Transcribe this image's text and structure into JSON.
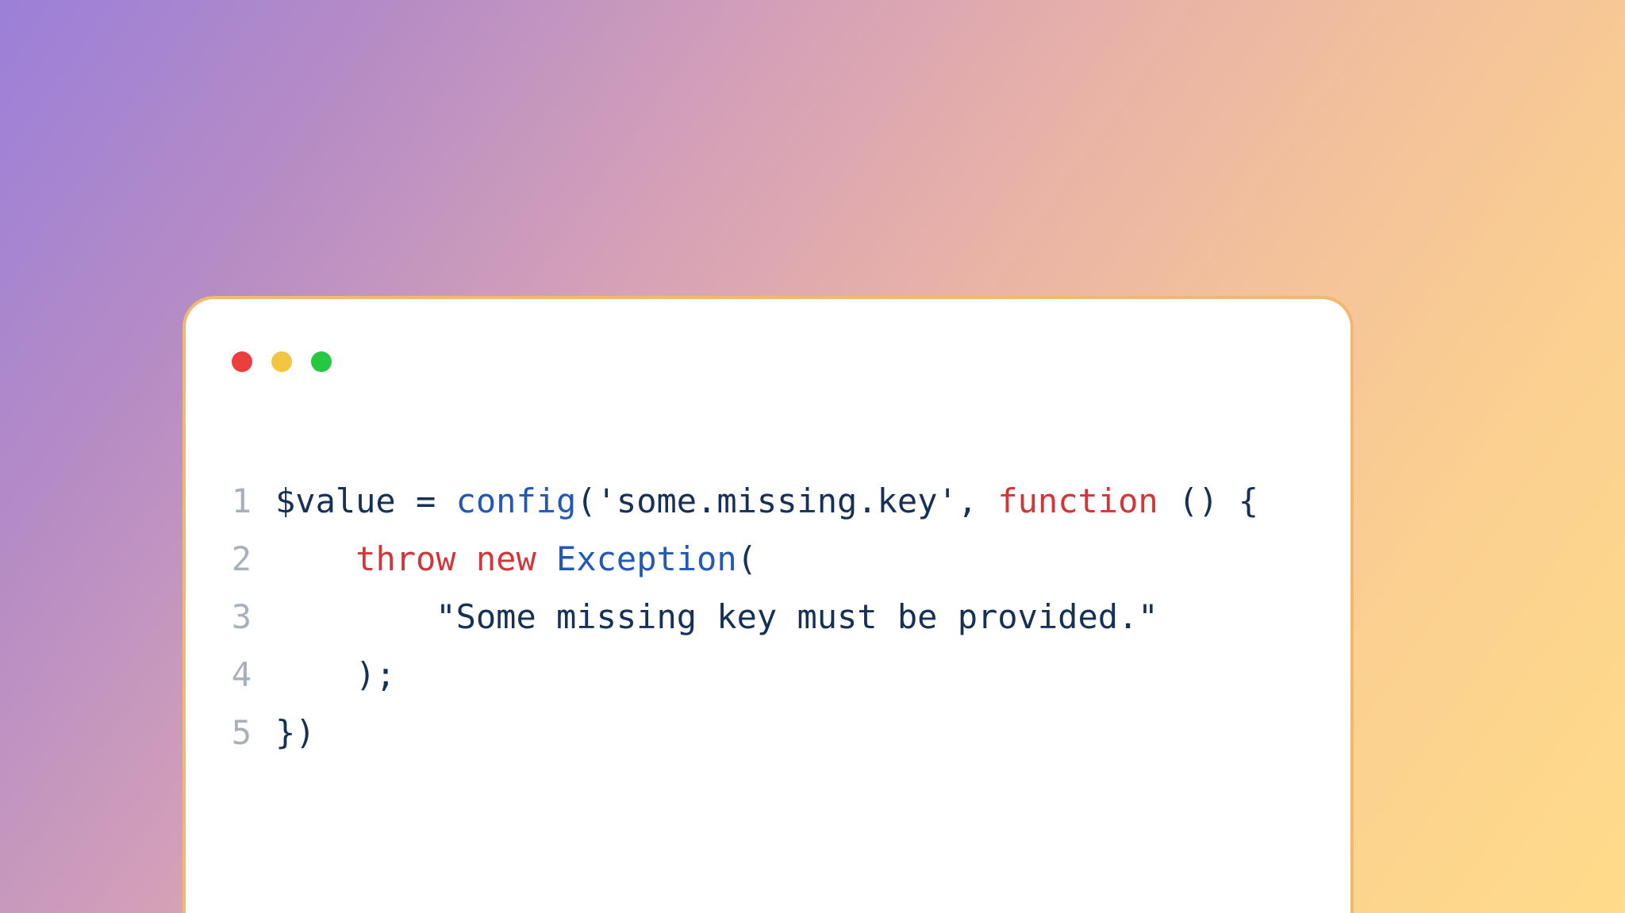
{
  "window": {
    "controls": {
      "close_color": "#ed3e3e",
      "minimize_color": "#f4c542",
      "zoom_color": "#26c840"
    }
  },
  "code": {
    "lines": [
      {
        "num": "1",
        "tokens": [
          {
            "t": "$value",
            "c": "tok-var"
          },
          {
            "t": " ",
            "c": "tok-plain"
          },
          {
            "t": "=",
            "c": "tok-op"
          },
          {
            "t": " ",
            "c": "tok-plain"
          },
          {
            "t": "config",
            "c": "tok-call"
          },
          {
            "t": "(",
            "c": "tok-punct"
          },
          {
            "t": "'some.missing.key'",
            "c": "tok-string"
          },
          {
            "t": ", ",
            "c": "tok-punct"
          },
          {
            "t": "function",
            "c": "tok-kw"
          },
          {
            "t": " () {",
            "c": "tok-punct"
          }
        ]
      },
      {
        "num": "2",
        "tokens": [
          {
            "t": "    ",
            "c": "tok-plain"
          },
          {
            "t": "throw",
            "c": "tok-kw"
          },
          {
            "t": " ",
            "c": "tok-plain"
          },
          {
            "t": "new",
            "c": "tok-kw"
          },
          {
            "t": " ",
            "c": "tok-plain"
          },
          {
            "t": "Exception",
            "c": "tok-class"
          },
          {
            "t": "(",
            "c": "tok-punct"
          }
        ]
      },
      {
        "num": "3",
        "tokens": [
          {
            "t": "        ",
            "c": "tok-plain"
          },
          {
            "t": "\"Some missing key must be provided.\"",
            "c": "tok-string"
          }
        ]
      },
      {
        "num": "4",
        "tokens": [
          {
            "t": "    );",
            "c": "tok-punct"
          }
        ]
      },
      {
        "num": "5",
        "tokens": [
          {
            "t": "})",
            "c": "tok-punct"
          }
        ]
      }
    ]
  }
}
